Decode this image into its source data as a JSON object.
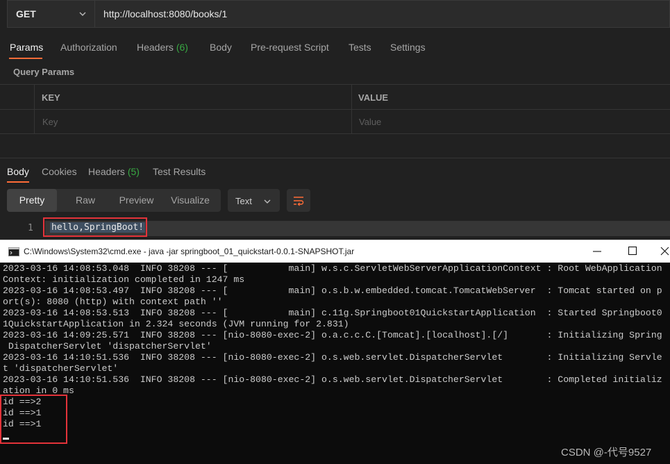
{
  "request": {
    "method": "GET",
    "url": "http://localhost:8080/books/1"
  },
  "request_tabs": [
    {
      "label": "Params"
    },
    {
      "label": "Authorization"
    },
    {
      "label": "Headers",
      "count": "(6)"
    },
    {
      "label": "Body"
    },
    {
      "label": "Pre-request Script"
    },
    {
      "label": "Tests"
    },
    {
      "label": "Settings"
    }
  ],
  "query_params": {
    "title": "Query Params",
    "key_header": "KEY",
    "value_header": "VALUE",
    "key_placeholder": "Key",
    "value_placeholder": "Value"
  },
  "response_tabs": [
    {
      "label": "Body"
    },
    {
      "label": "Cookies"
    },
    {
      "label": "Headers",
      "count": "(5)"
    },
    {
      "label": "Test Results"
    }
  ],
  "view_modes": [
    "Pretty",
    "Raw",
    "Preview",
    "Visualize"
  ],
  "format": "Text",
  "response": {
    "line_number": "1",
    "text": "hello,SpringBoot!"
  },
  "cmd": {
    "title": "C:\\Windows\\System32\\cmd.exe - java  -jar springboot_01_quickstart-0.0.1-SNAPSHOT.jar",
    "lines": [
      "2023-03-16 14:08:53.048  INFO 38208 --- [           main] w.s.c.ServletWebServerApplicationContext : Root WebApplication",
      "Context: initialization completed in 1247 ms",
      "2023-03-16 14:08:53.497  INFO 38208 --- [           main] o.s.b.w.embedded.tomcat.TomcatWebServer  : Tomcat started on p",
      "ort(s): 8080 (http) with context path ''",
      "2023-03-16 14:08:53.513  INFO 38208 --- [           main] c.11g.Springboot01QuickstartApplication  : Started Springboot0",
      "1QuickstartApplication in 2.324 seconds (JVM running for 2.831)",
      "2023-03-16 14:09:25.571  INFO 38208 --- [nio-8080-exec-2] o.a.c.c.C.[Tomcat].[localhost].[/]       : Initializing Spring",
      " DispatcherServlet 'dispatcherServlet'",
      "2023-03-16 14:10:51.536  INFO 38208 --- [nio-8080-exec-2] o.s.web.servlet.DispatcherServlet        : Initializing Servle",
      "t 'dispatcherServlet'",
      "2023-03-16 14:10:51.536  INFO 38208 --- [nio-8080-exec-2] o.s.web.servlet.DispatcherServlet        : Completed initializ",
      "ation in 0 ms",
      "id ==>2",
      "id ==>1",
      "id ==>1"
    ]
  },
  "watermark": "CSDN @-代号9527",
  "colors": {
    "accent": "#ff6c37",
    "count_green": "#38a843",
    "highlight_red": "#e4333a"
  }
}
